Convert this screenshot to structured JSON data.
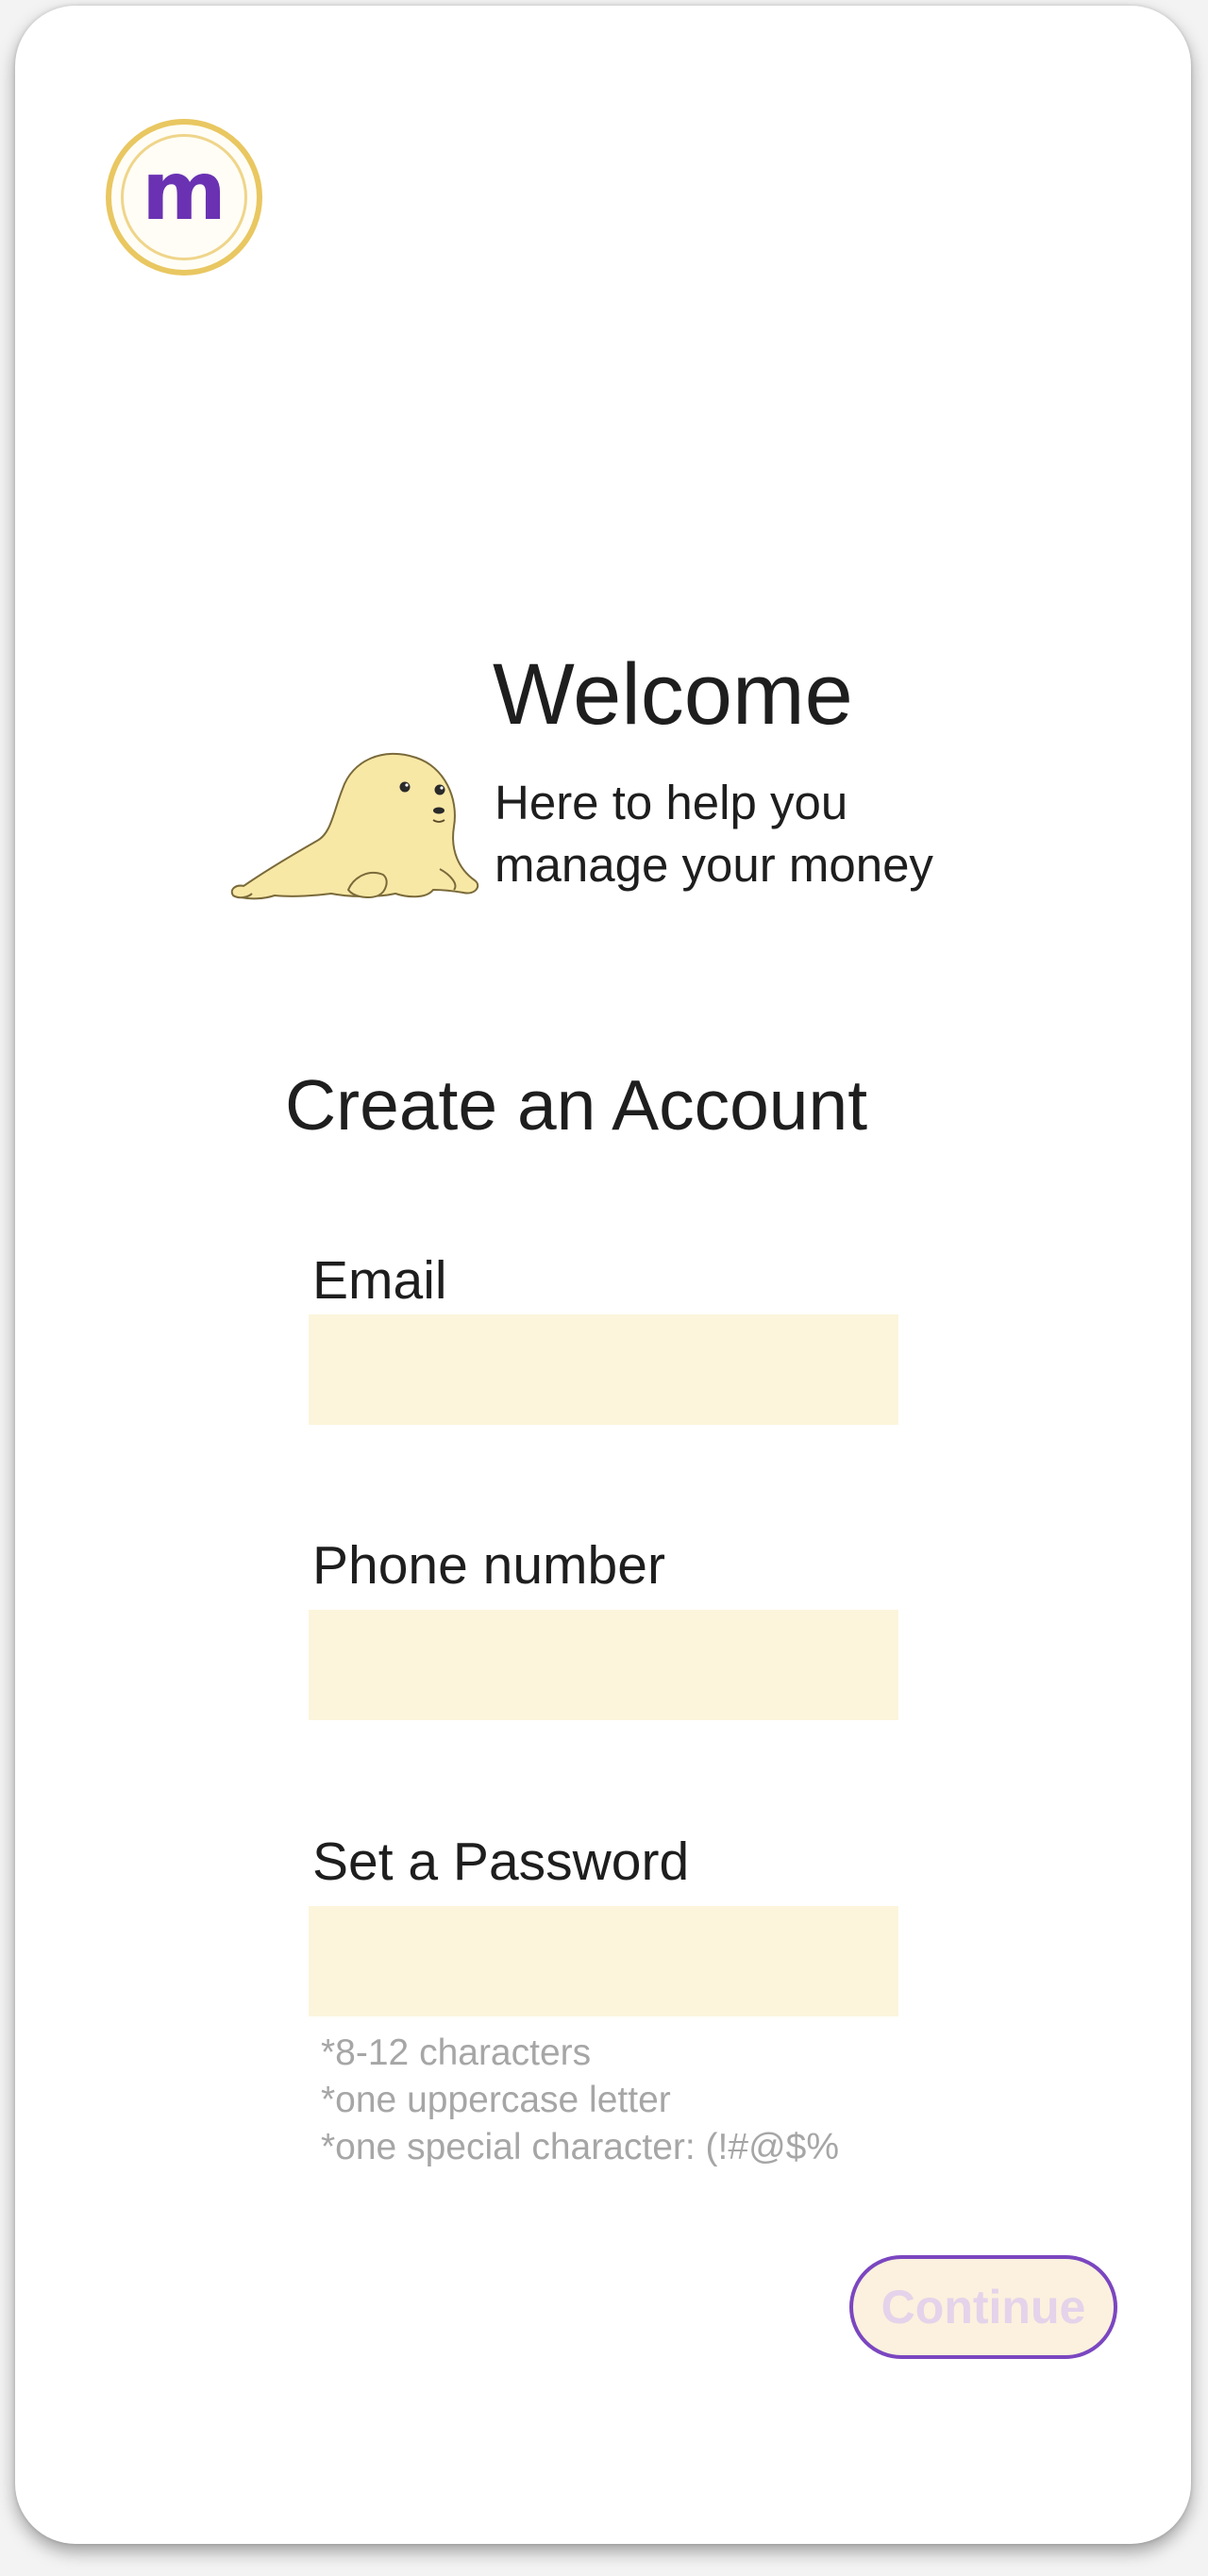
{
  "app": {
    "logo_letter": "m",
    "brand_color": "#6a32b3",
    "accent_color": "#e9c761",
    "input_background": "#fcf5dc"
  },
  "welcome": {
    "title": "Welcome",
    "subtitle_line1": "Here to help you",
    "subtitle_line2": "manage your money",
    "mascot_icon": "baby-seal-icon"
  },
  "form": {
    "title": "Create an Account",
    "email_label": "Email",
    "email_value": "",
    "phone_label": "Phone number",
    "phone_value": "",
    "password_label": "Set a Password",
    "password_value": "",
    "password_hints": [
      "*8-12 characters",
      "*one uppercase letter",
      "*one special character: (!#@$%"
    ],
    "continue_label": "Continue"
  }
}
